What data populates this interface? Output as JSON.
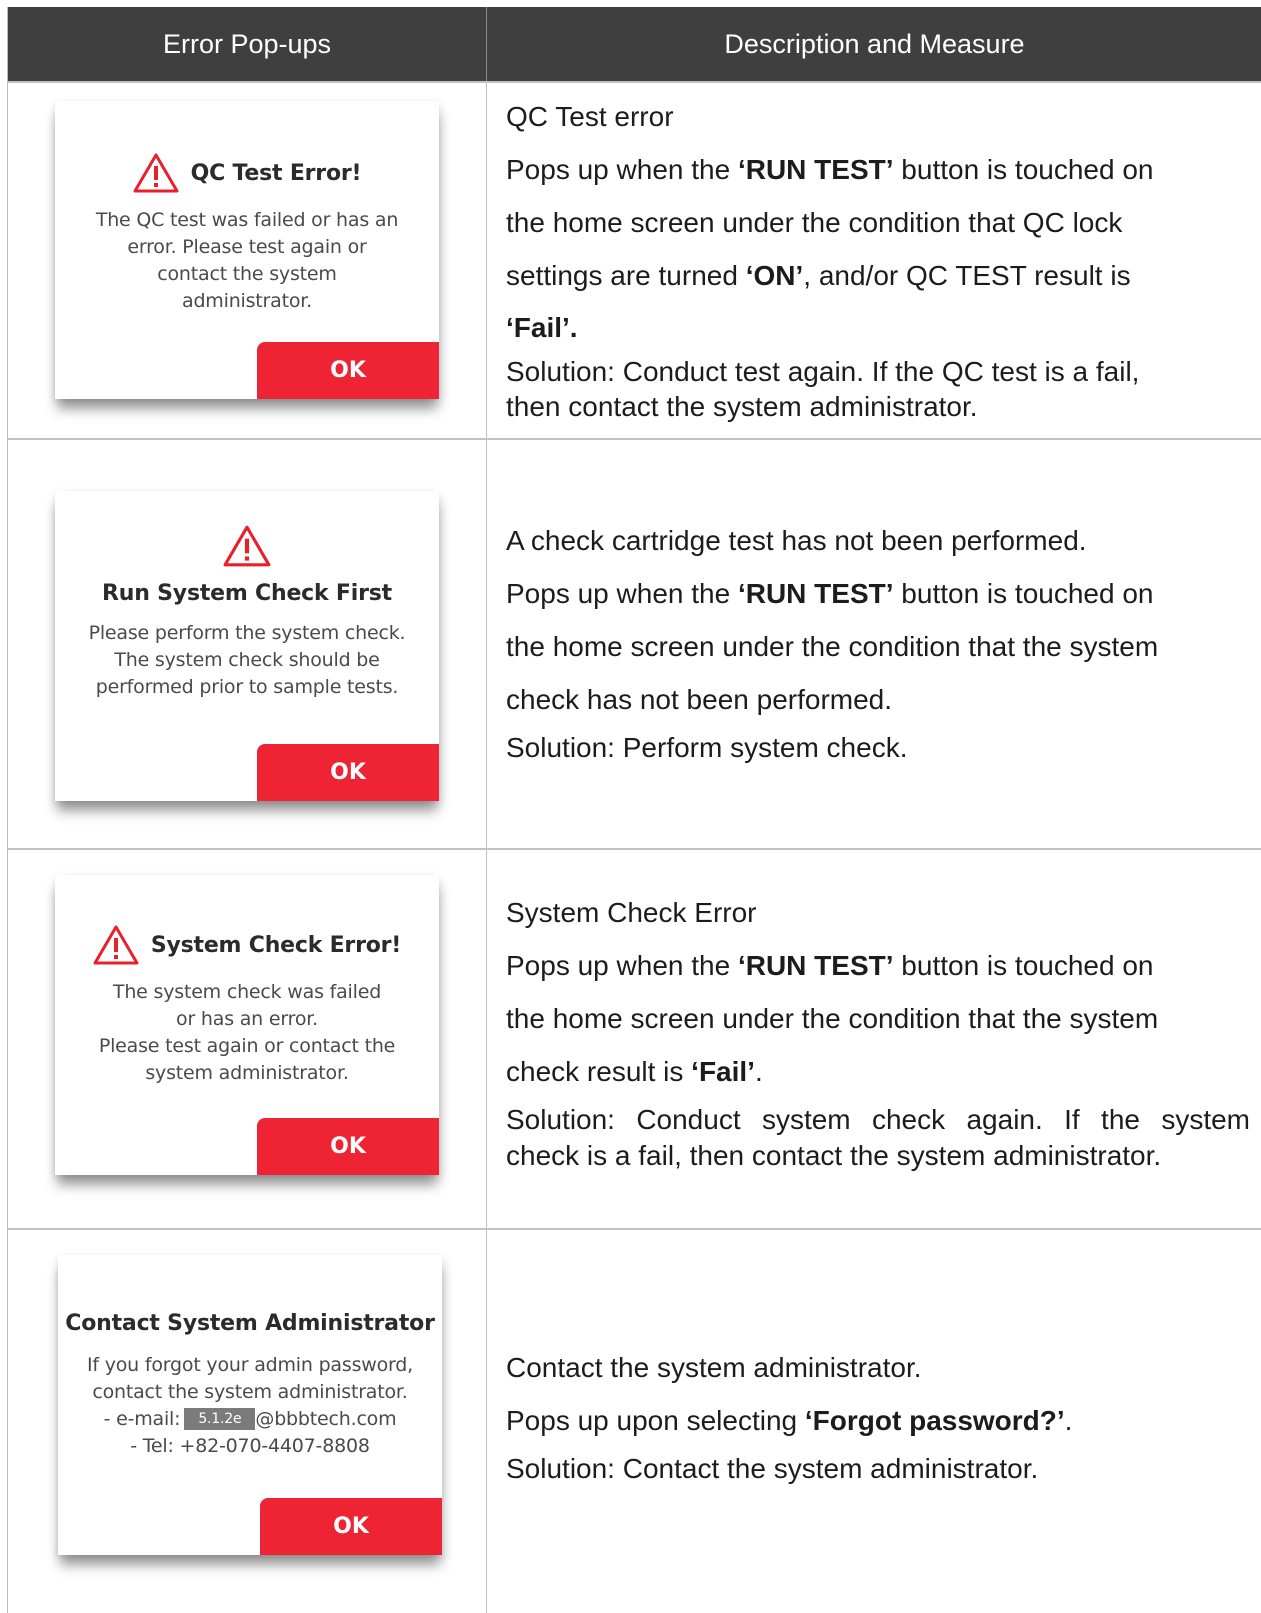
{
  "header": {
    "col1": "Error Pop-ups",
    "col2": "Description and Measure"
  },
  "rows": [
    {
      "popup": {
        "title": "QC Test Error!",
        "icon": "warning-triangle-icon",
        "lines": [
          "The QC test was failed or has an",
          "error. Please test again or",
          "contact the system",
          "administrator."
        ],
        "ok": "OK"
      },
      "desc": {
        "heading": "QC Test error",
        "p1_pre": "Pops up when the ",
        "p1_bold": "‘RUN TEST’",
        "p1_post": " button is touched on",
        "p2": "the home screen under the condition that QC lock",
        "p3_pre": "settings are turned ",
        "p3_bold": "‘ON’",
        "p3_post": ", and/or QC TEST result is",
        "p4_bold": "‘Fail’.",
        "sol1": "Solution: Conduct test again. If the QC test is a fail,",
        "sol2": "then contact the system administrator."
      }
    },
    {
      "popup": {
        "title": "Run System Check First",
        "icon": "warning-triangle-icon",
        "lines": [
          "Please perform the system check.",
          "The system check should be",
          "performed prior to sample tests."
        ],
        "ok": "OK"
      },
      "desc": {
        "heading": "A check cartridge test has not been performed.",
        "p1_pre": "Pops up when the ",
        "p1_bold": "‘RUN TEST’",
        "p1_post": " button is touched on",
        "p2": "the home screen under the condition that the system",
        "p3": "check has not been performed.",
        "sol1": "Solution: Perform system check."
      }
    },
    {
      "popup": {
        "title": "System Check Error!",
        "icon": "warning-triangle-icon",
        "lines": [
          "The system check was failed",
          "or has an error.",
          "Please test again or contact the",
          "system administrator."
        ],
        "ok": "OK"
      },
      "desc": {
        "heading": "System Check Error",
        "p1_pre": "Pops up when the ",
        "p1_bold": "‘RUN TEST’",
        "p1_post": " button is touched on",
        "p2": "the home screen under the condition that the system",
        "p3_pre": "check result is ",
        "p3_bold": "‘Fail’",
        "p3_post": ".",
        "sol1": "Solution: Conduct system check again. If the system",
        "sol2": "check is a fail, then contact the system administrator."
      }
    },
    {
      "popup": {
        "title": "Contact System Administrator",
        "lines": [
          "If you forgot your admin password,",
          "contact the system administrator."
        ],
        "email_prefix": "- e-mail:",
        "email_mask": "5.1.2e",
        "email_suffix": "@bbbtech.com",
        "tel": "- Tel: +82-070-4407-8808",
        "ok": "OK"
      },
      "desc": {
        "heading": "Contact the system administrator.",
        "p1_pre": "Pops up upon selecting ",
        "p1_bold": "‘Forgot password?’",
        "p1_post": ".",
        "sol1": "Solution: Contact the system administrator."
      }
    }
  ],
  "colors": {
    "header_bg": "#3f3f3f",
    "ok_button": "#ee2434",
    "warning_icon": "#e8202c"
  }
}
